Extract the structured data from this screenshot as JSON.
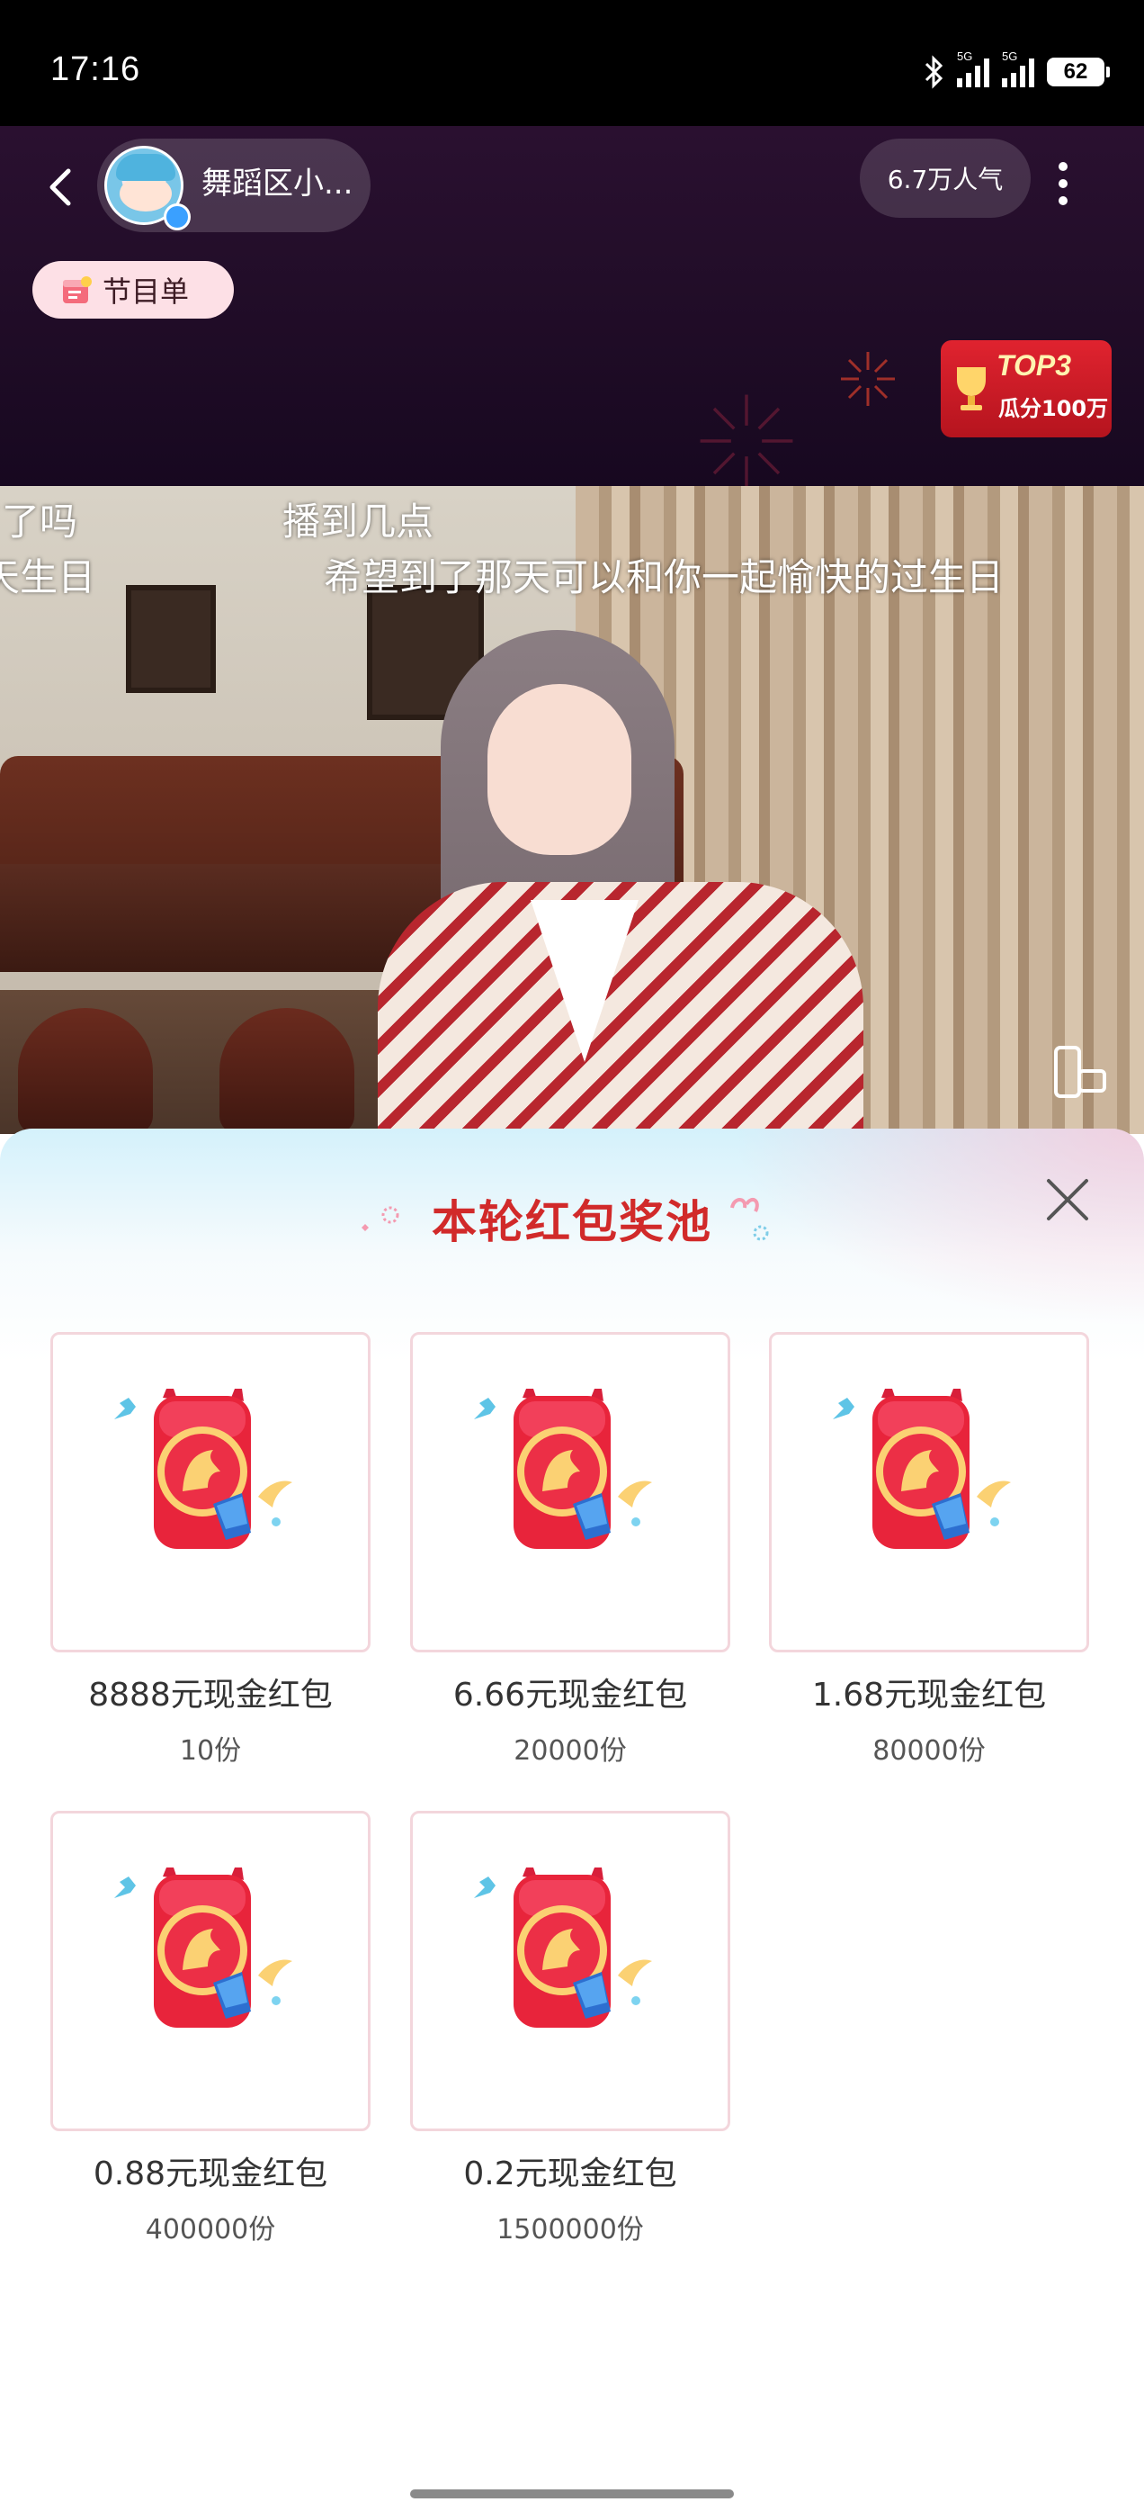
{
  "status_bar": {
    "time": "17:16",
    "signal1_label": "5G",
    "signal2_label": "5G",
    "battery": "62",
    "icons": [
      "bluetooth-icon",
      "signal-icon",
      "signal-icon",
      "battery-icon"
    ]
  },
  "live_header": {
    "streamer_name": "舞蹈区小...",
    "popularity": "6.7万人气",
    "program_label": "节目单",
    "top_badge": {
      "title": "TOP3",
      "subtitle": "瓜分100万"
    }
  },
  "video": {
    "danmu": [
      {
        "text": "了了吗",
        "row": 1
      },
      {
        "text": "播到几点",
        "row": 1
      },
      {
        "text": "天生日",
        "row": 2
      },
      {
        "text": "希望到了那天可以和你一起愉快的过生日",
        "row": 2
      }
    ]
  },
  "sheet": {
    "title": "本轮红包奖池",
    "prizes": [
      {
        "name": "8888元现金红包",
        "count": "10份"
      },
      {
        "name": "6.66元现金红包",
        "count": "20000份"
      },
      {
        "name": "1.68元现金红包",
        "count": "80000份"
      },
      {
        "name": "0.88元现金红包",
        "count": "400000份"
      },
      {
        "name": "0.2元现金红包",
        "count": "1500000份"
      }
    ],
    "colors": {
      "title": "#d12a2a",
      "card_border": "#f3d6dc",
      "envelope": "#e8243b"
    }
  }
}
